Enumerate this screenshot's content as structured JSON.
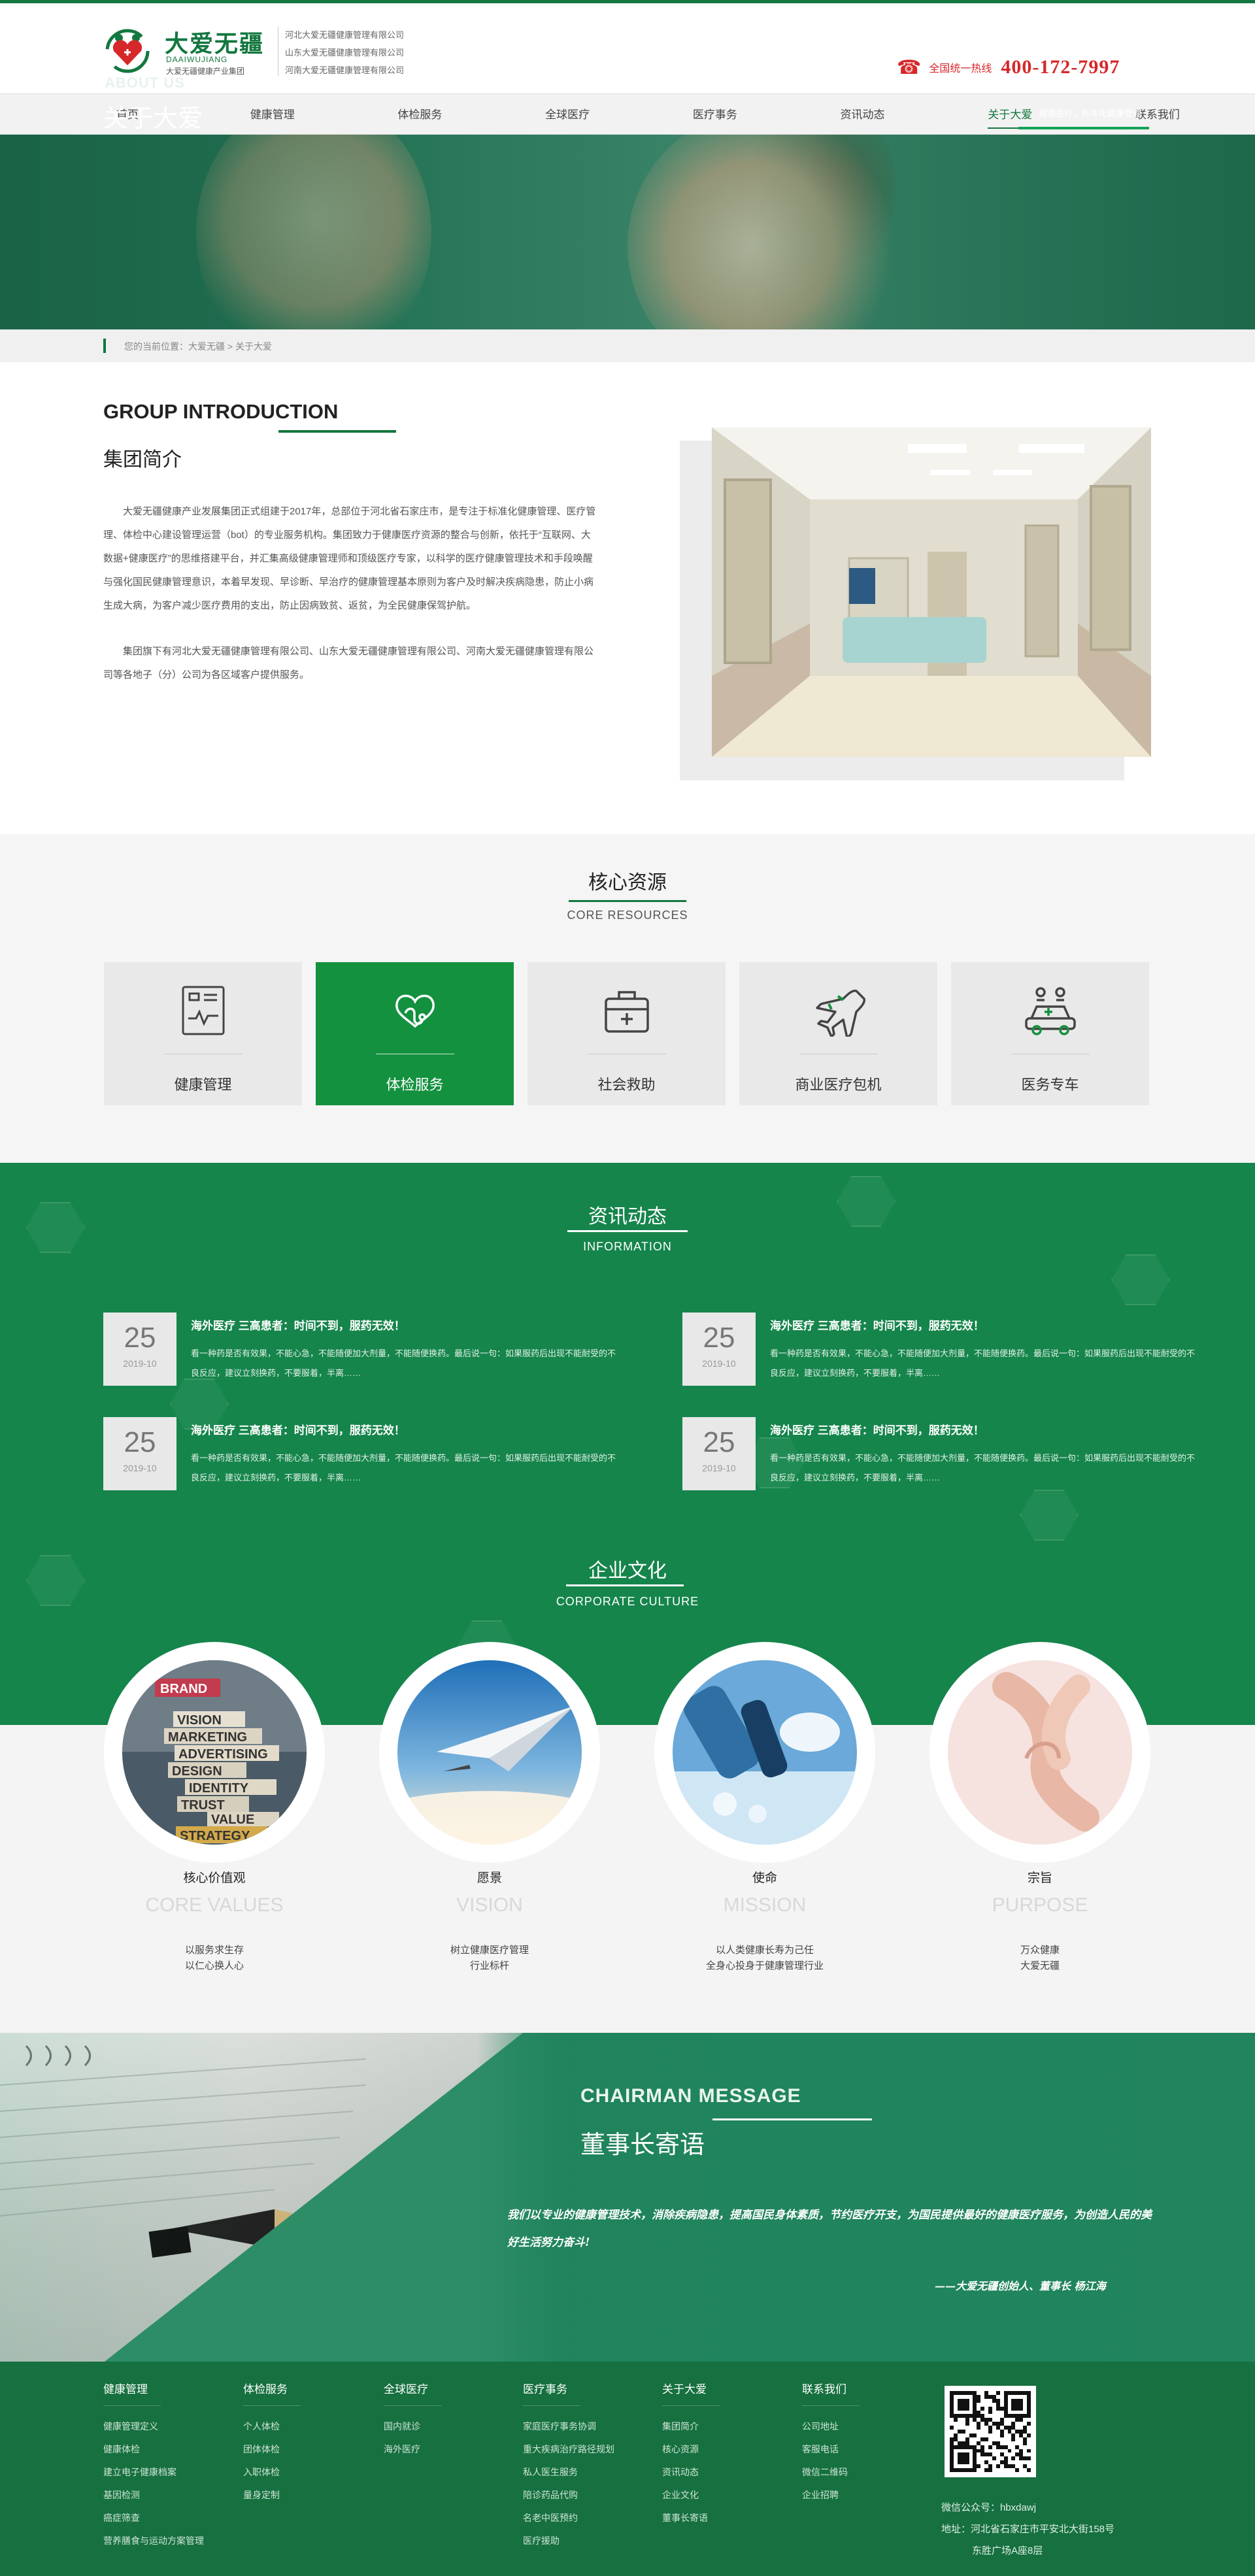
{
  "header": {
    "logo_cn": "大爱无疆",
    "logo_en": "DAAIWUJIANG",
    "logo_slogan": "大爱无疆健康产业集团",
    "subsidiaries": [
      "河北大爱无疆健康管理有限公司",
      "山东大爱无疆健康管理有限公司",
      "河南大爱无疆健康管理有限公司"
    ],
    "hotline_label": "全国统一热线",
    "hotline": "400-172-7997"
  },
  "nav": [
    "首页",
    "健康管理",
    "体检服务",
    "全球医疗",
    "医疗事务",
    "资讯动态",
    "关于大爱",
    "联系我们"
  ],
  "nav_active_index": 6,
  "banner": {
    "en": "ABOUT US",
    "cn": "关于大爱",
    "tag": "健康医疗，标本化健康管理"
  },
  "breadcrumb": "您的当前位置：大爱无疆 > 关于大爱",
  "intro": {
    "en": "GROUP INTRODUCTION",
    "cn": "集团简介",
    "p1": "大爱无疆健康产业发展集团正式组建于2017年，总部位于河北省石家庄市，是专注于标准化健康管理、医疗管理、体检中心建设管理运营（bot）的专业服务机构。集团致力于健康医疗资源的整合与创新，依托于“互联网、大数据+健康医疗”的思维搭建平台，并汇集高级健康管理师和顶级医疗专家，以科学的医疗健康管理技术和手段唤醒与强化国民健康管理意识，本着早发现、早诊断、早治疗的健康管理基本原则为客户及时解决疾病隐患，防止小病生成大病，为客户减少医疗费用的支出，防止因病致贫、返贫，为全民健康保驾护航。",
    "p2": "集团旗下有河北大爱无疆健康管理有限公司、山东大爱无疆健康管理有限公司、河南大爱无疆健康管理有限公司等各地子（分）公司为各区域客户提供服务。"
  },
  "core": {
    "cn": "核心资源",
    "en": "CORE RESOURCES",
    "items": [
      {
        "label": "健康管理",
        "icon": "health-report-icon"
      },
      {
        "label": "体检服务",
        "icon": "stethoscope-icon"
      },
      {
        "label": "社会救助",
        "icon": "medical-kit-icon"
      },
      {
        "label": "商业医疗包机",
        "icon": "airplane-icon"
      },
      {
        "label": "医务专车",
        "icon": "car-icon"
      }
    ],
    "active_index": 1
  },
  "info": {
    "cn": "资讯动态",
    "en": "INFORMATION",
    "news": [
      {
        "day": "25",
        "ym": "2019-10",
        "title": "海外医疗 三高患者：时间不到，服药无效！",
        "desc": "看一种药是否有效果，不能心急，不能随便加大剂量，不能随便换药。最后说一句：如果服药后出现不能耐受的不良反应，建议立刻换药，不要服着，半离……"
      },
      {
        "day": "25",
        "ym": "2019-10",
        "title": "海外医疗 三高患者：时间不到，服药无效！",
        "desc": "看一种药是否有效果，不能心急，不能随便加大剂量，不能随便换药。最后说一句：如果服药后出现不能耐受的不良反应，建议立刻换药，不要服着，半离……"
      },
      {
        "day": "25",
        "ym": "2019-10",
        "title": "海外医疗 三高患者：时间不到，服药无效！",
        "desc": "看一种药是否有效果，不能心急，不能随便加大剂量，不能随便换药。最后说一句：如果服药后出现不能耐受的不良反应，建议立刻换药，不要服着，半离……"
      },
      {
        "day": "25",
        "ym": "2019-10",
        "title": "海外医疗 三高患者：时间不到，服药无效！",
        "desc": "看一种药是否有效果，不能心急，不能随便加大剂量，不能随便换药。最后说一句：如果服药后出现不能耐受的不良反应，建议立刻换药，不要服着，半离……"
      }
    ]
  },
  "culture": {
    "cn": "企业文化",
    "en": "CORPORATE CULTURE",
    "items": [
      {
        "cn": "核心价值观",
        "en": "CORE VALUES",
        "d1": "以服务求生存",
        "d2": "以仁心换人心"
      },
      {
        "cn": "愿景",
        "en": "VISION",
        "d1": "树立健康医疗管理",
        "d2": "行业标杆"
      },
      {
        "cn": "使命",
        "en": "MISSION",
        "d1": "以人类健康长寿为己任",
        "d2": "全身心投身于健康管理行业"
      },
      {
        "cn": "宗旨",
        "en": "PURPOSE",
        "d1": "万众健康",
        "d2": "大爱无疆"
      }
    ],
    "values_words": [
      "BRAND",
      "VISION",
      "MARKETING",
      "ADVERTISING",
      "DESIGN",
      "IDENTITY",
      "TRUST",
      "VALUE",
      "STRATEGY"
    ]
  },
  "chairman": {
    "en": "CHAIRMAN MESSAGE",
    "cn": "董事长寄语",
    "body": "我们以专业的健康管理技术，消除疾病隐患，提高国民身体素质，节约医疗开支，为国民提供最好的健康医疗服务，为创造人民的美好生活努力奋斗!",
    "sign": "——大爱无疆创始人、董事长 杨江海"
  },
  "footer": {
    "cols": [
      {
        "h": "健康管理",
        "items": [
          "健康管理定义",
          "健康体检",
          "建立电子健康档案",
          "基因检测",
          "癌症筛查",
          "营养膳食与运动方案管理"
        ]
      },
      {
        "h": "体检服务",
        "items": [
          "个人体检",
          "团体体检",
          "入职体检",
          "量身定制"
        ]
      },
      {
        "h": "全球医疗",
        "items": [
          "国内就诊",
          "海外医疗"
        ]
      },
      {
        "h": "医疗事务",
        "items": [
          "家庭医疗事务协调",
          "重大疾病治疗路径规划",
          "私人医生服务",
          "陪诊药品代购",
          "名老中医预约",
          "医疗援助"
        ]
      },
      {
        "h": "关于大爱",
        "items": [
          "集团简介",
          "核心资源",
          "资讯动态",
          "企业文化",
          "董事长寄语"
        ]
      },
      {
        "h": "联系我们",
        "items": [
          "公司地址",
          "客服电话",
          "微信二维码",
          "企业招聘"
        ]
      }
    ],
    "wechat": "微信公众号：hbxdawj",
    "address1": "地址：河北省石家庄市平安北大街158号",
    "address2": "东胜广场A座8层"
  },
  "colors": {
    "brand_green": "#13773f",
    "active_green": "#13913f",
    "hotline_red": "#d6282a"
  }
}
